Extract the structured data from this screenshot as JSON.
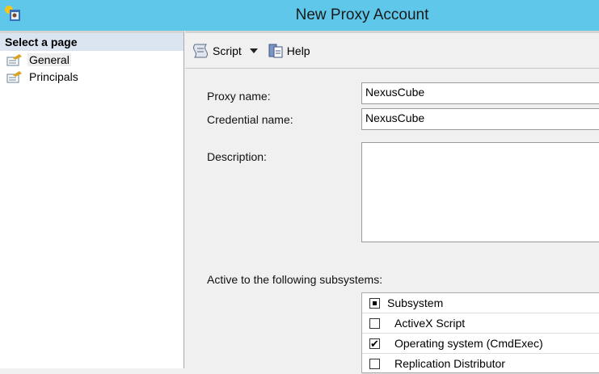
{
  "window": {
    "title": "New Proxy Account"
  },
  "sidebar": {
    "header": "Select a page",
    "items": [
      {
        "label": "General",
        "selected": true
      },
      {
        "label": "Principals",
        "selected": false
      }
    ]
  },
  "toolbar": {
    "script_label": "Script",
    "help_label": "Help"
  },
  "form": {
    "proxy_name_label": "Proxy name:",
    "proxy_name_value": "NexusCube",
    "credential_name_label": "Credential name:",
    "credential_name_value": "NexusCube",
    "description_label": "Description:",
    "description_value": "",
    "subsystems_label": "Active to the following subsystems:"
  },
  "subsystems": {
    "header": "Subsystem",
    "rows": [
      {
        "name": "ActiveX Script",
        "checked": false
      },
      {
        "name": "Operating system (CmdExec)",
        "checked": true
      },
      {
        "name": "Replication Distributor",
        "checked": false
      }
    ]
  }
}
